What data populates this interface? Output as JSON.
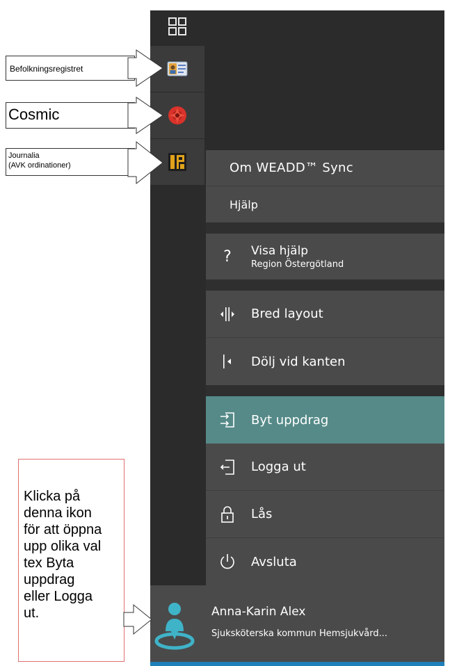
{
  "annotations": {
    "befolkning": "Befolkningsregistret",
    "cosmic": "Cosmic",
    "journalia_line1": "Journalia",
    "journalia_line2": "(AVK ordinationer)",
    "note": "Klicka på\ndenna ikon\nför att öppna\nupp olika val\ntex Byta\nuppdrag\neller Logga\nut."
  },
  "rail": {
    "items": [
      {
        "icon": "apps-grid-icon"
      },
      {
        "icon": "id-card-icon"
      },
      {
        "icon": "cosmic-icon"
      },
      {
        "icon": "journalia-icon"
      }
    ]
  },
  "menu": {
    "about": "Om  WEADD™ Sync",
    "help": "Hjälp",
    "show_help_title": "Visa hjälp",
    "show_help_sub": "Region Östergötland",
    "wide_layout": "Bred layout",
    "hide_edge": "Dölj vid kanten",
    "switch_assignment": "Byt uppdrag",
    "logout": "Logga ut",
    "lock": "Lås",
    "quit": "Avsluta",
    "help_icon_glyph": "?"
  },
  "user": {
    "name": "Anna-Karin Alex",
    "role": "Sjuksköterska  kommun  Hemsjukvård..."
  },
  "colors": {
    "panel": "#2b2b2b",
    "menu_item": "#4a4a4a",
    "highlight": "#558a88",
    "avatar": "#3fb3c8",
    "accent_strip": "#1f7fb8"
  }
}
